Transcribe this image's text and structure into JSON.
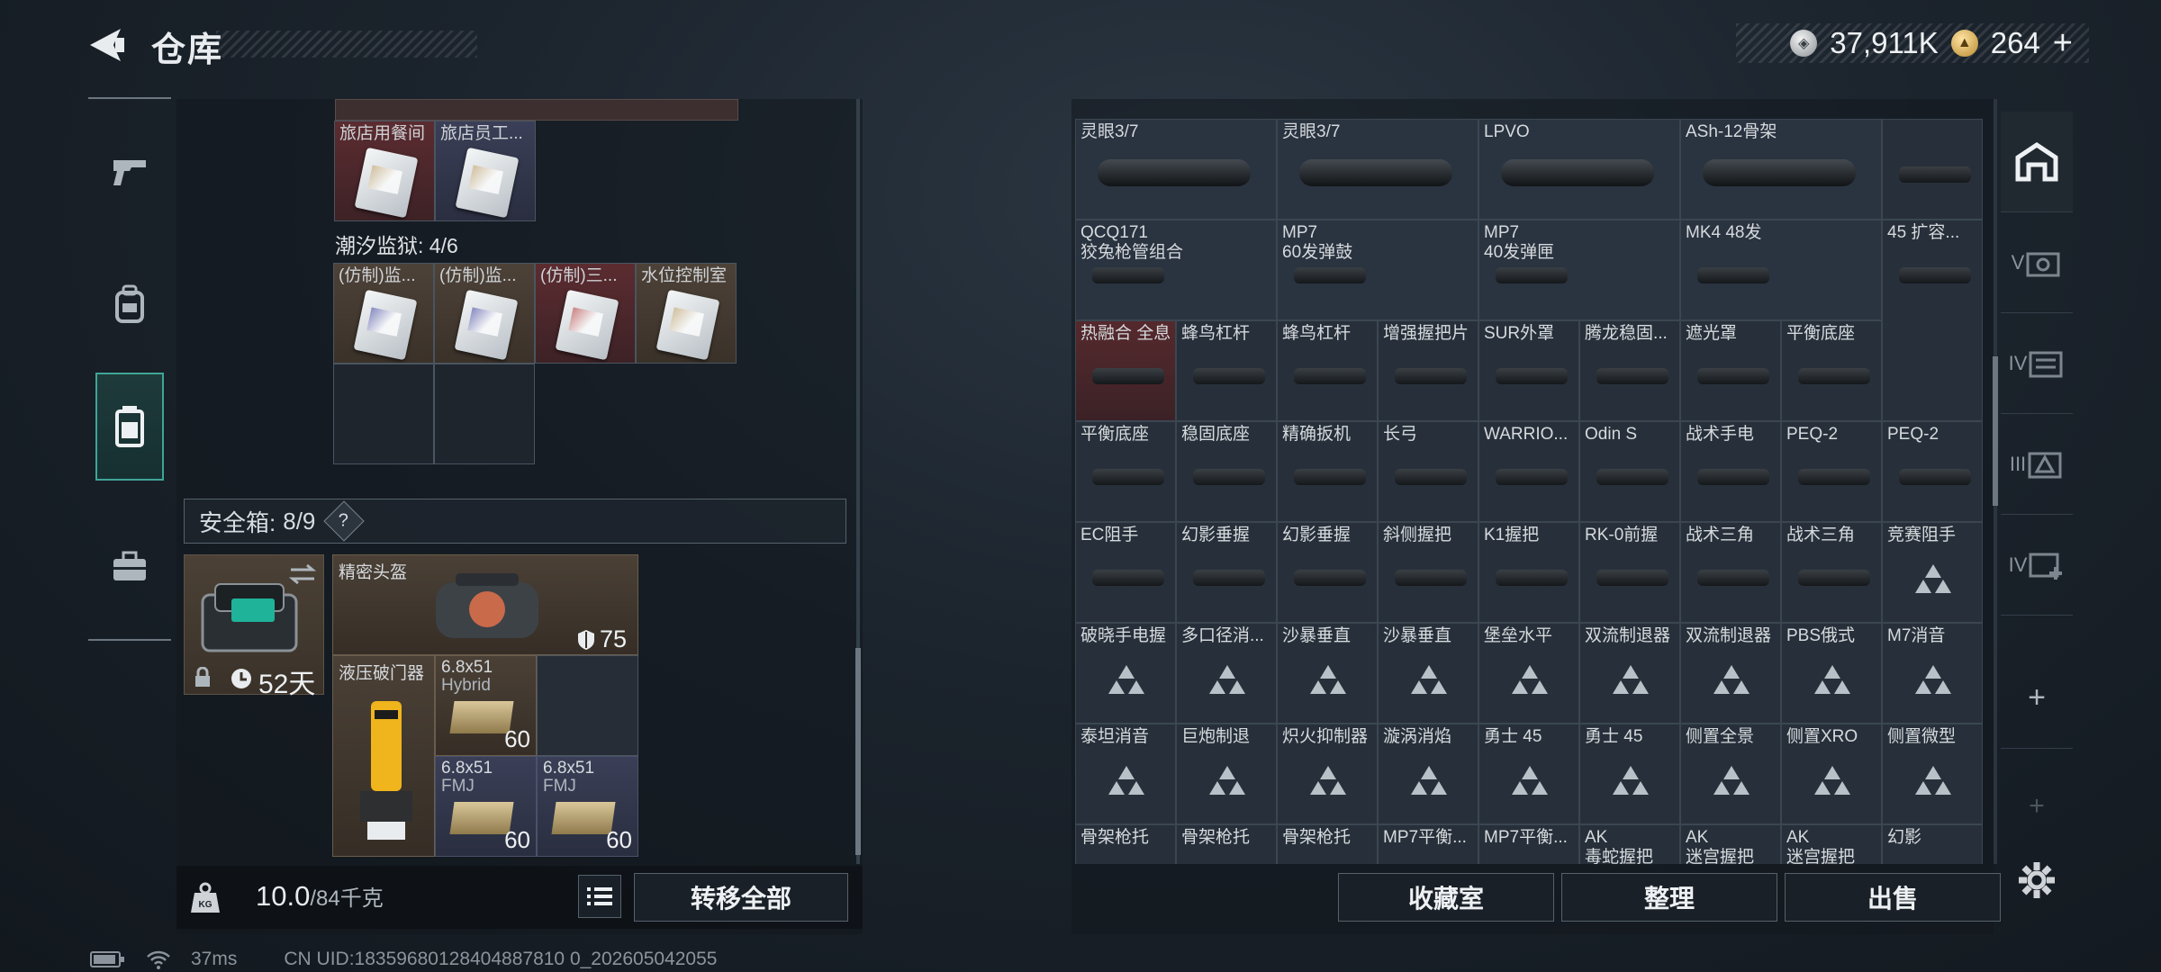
{
  "header": {
    "title": "仓库",
    "currency_silver": "37,911K",
    "currency_gold": "264",
    "gold_plus": "+"
  },
  "left": {
    "section_hotel": [
      {
        "label": "旅店用餐间",
        "style": "red"
      },
      {
        "label": "旅店员工...",
        "style": "blue"
      }
    ],
    "section_prison_title": "潮汐监狱: 4/6",
    "section_prison": [
      {
        "label": "(仿制)监...",
        "style": "brown",
        "card": "violet"
      },
      {
        "label": "(仿制)监...",
        "style": "brown",
        "card": "violet"
      },
      {
        "label": "(仿制)三...",
        "style": "red",
        "card": "pink"
      },
      {
        "label": "水位控制室",
        "style": "brown",
        "card": "plain"
      }
    ],
    "safebox_label": "安全箱:",
    "safebox_count": "8/9",
    "safebox_help": "?",
    "safecase_days": "52天",
    "helmet_label": "精密头盔",
    "helmet_armor": "75",
    "breacher_label": "液压破门器",
    "ammo1": {
      "label": "6.8x51",
      "sub": "Hybrid",
      "count": "60"
    },
    "ammo2": {
      "label": "6.8x51",
      "sub": "FMJ",
      "count": "60"
    },
    "ammo3": {
      "label": "6.8x51",
      "sub": "FMJ",
      "count": "60"
    },
    "weight_value": "10.0",
    "weight_max": "/84千克",
    "transfer_all": "转移全部"
  },
  "right": {
    "row1": [
      "灵眼3/7",
      "灵眼3/7",
      "LPVO",
      "ASh-12骨架",
      ""
    ],
    "row2": [
      [
        "QCQ171",
        "狡兔枪管组合"
      ],
      [
        "MP7",
        "60发弹鼓"
      ],
      [
        "MP7",
        "40发弹匣"
      ],
      [
        "MK4 48发",
        ""
      ],
      [
        "45 扩容...",
        ""
      ]
    ],
    "row3": [
      "热融合 全息",
      "蜂鸟杠杆",
      "蜂鸟杠杆",
      "增强握把片",
      "SUR外罩",
      "腾龙稳固...",
      "遮光罩",
      "平衡底座"
    ],
    "row4": [
      "平衡底座",
      "稳固底座",
      "精确扳机",
      "长弓",
      "WARRIO...",
      "Odin S",
      "战术手电",
      "PEQ-2",
      "PEQ-2"
    ],
    "row5": [
      "EC阻手",
      "幻影垂握",
      "幻影垂握",
      "斜侧握把",
      "K1握把",
      "RK-0前握",
      "战术三角",
      "战术三角",
      "竞赛阻手"
    ],
    "row6": [
      "破晓手电握",
      "多口径消...",
      "沙暴垂直",
      "沙暴垂直",
      "堡垒水平",
      "双流制退器",
      "双流制退器",
      "PBS俄式",
      "M7消音"
    ],
    "row7": [
      "泰坦消音",
      "巨炮制退",
      "炽火抑制器",
      "漩涡消焰",
      "勇士 45",
      "勇士 45",
      "侧置全景",
      "侧置XRO",
      "侧置微型"
    ],
    "row8": [
      "骨架枪托",
      "骨架枪托",
      "骨架枪托",
      "MP7平衡...",
      "MP7平衡...",
      "AK",
      "AK",
      "AK",
      "幻影"
    ],
    "row8_sub": [
      "",
      "",
      "",
      "",
      "",
      "毒蛇握把",
      "迷宫握把",
      "迷宫握把",
      ""
    ],
    "btn_collection": "收藏室",
    "btn_sort": "整理",
    "btn_sell": "出售",
    "tab_labels": [
      "V",
      "IV",
      "III",
      "IV"
    ],
    "tab_plus": "+"
  },
  "status": {
    "ping": "37ms",
    "uid": "CN UID:18359680128404887810 0_202605042055"
  }
}
